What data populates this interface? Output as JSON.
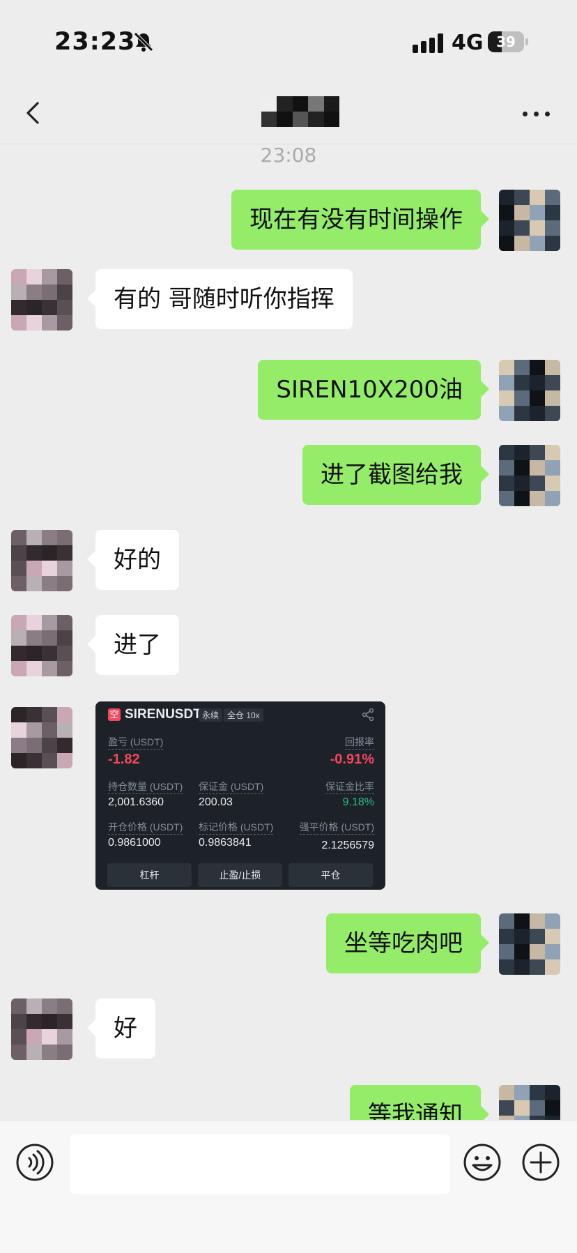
{
  "status": {
    "time": "23:23",
    "network": "4G",
    "battery": "39",
    "battery_level": 0.39
  },
  "chat": {
    "timestamp": "23:08",
    "messages": [
      {
        "side": "me",
        "text": "现在有没有时间操作"
      },
      {
        "side": "them",
        "text": "有的 哥随时听你指挥"
      },
      {
        "side": "me",
        "text": "SIREN10X200油"
      },
      {
        "side": "me",
        "text": "进了截图给我"
      },
      {
        "side": "them",
        "text": "好的"
      },
      {
        "side": "them",
        "text": "进了"
      },
      {
        "side": "me",
        "text": "坐等吃肉吧"
      },
      {
        "side": "them",
        "text": "好"
      },
      {
        "side": "me",
        "text": "等我通知"
      }
    ],
    "trade_card": {
      "badge": "空",
      "symbol": "SIRENUSDT",
      "tag_perpetual": "永续",
      "tag_margin": "全仓 10x",
      "pnl_label": "盈亏 (USDT)",
      "pnl_value": "-1.82",
      "roe_label": "回报率",
      "roe_value": "-0.91%",
      "size_label": "持仓数量 (USDT)",
      "size_value": "2,001.6360",
      "margin_label": "保证金 (USDT)",
      "margin_value": "200.03",
      "margin_ratio_label": "保证金比率",
      "margin_ratio_value": "9.18%",
      "entry_label": "开仓价格 (USDT)",
      "entry_value": "0.9861000",
      "mark_label": "标记价格 (USDT)",
      "mark_value": "0.9863841",
      "liq_label": "强平价格 (USDT)",
      "liq_value": "2.1256579",
      "btn_leverage": "杠杆",
      "btn_tpsl": "止盈/止损",
      "btn_close": "平仓"
    }
  },
  "colors": {
    "my_bubble": "#95ec69",
    "their_bubble": "#ffffff",
    "background": "#ededed"
  }
}
